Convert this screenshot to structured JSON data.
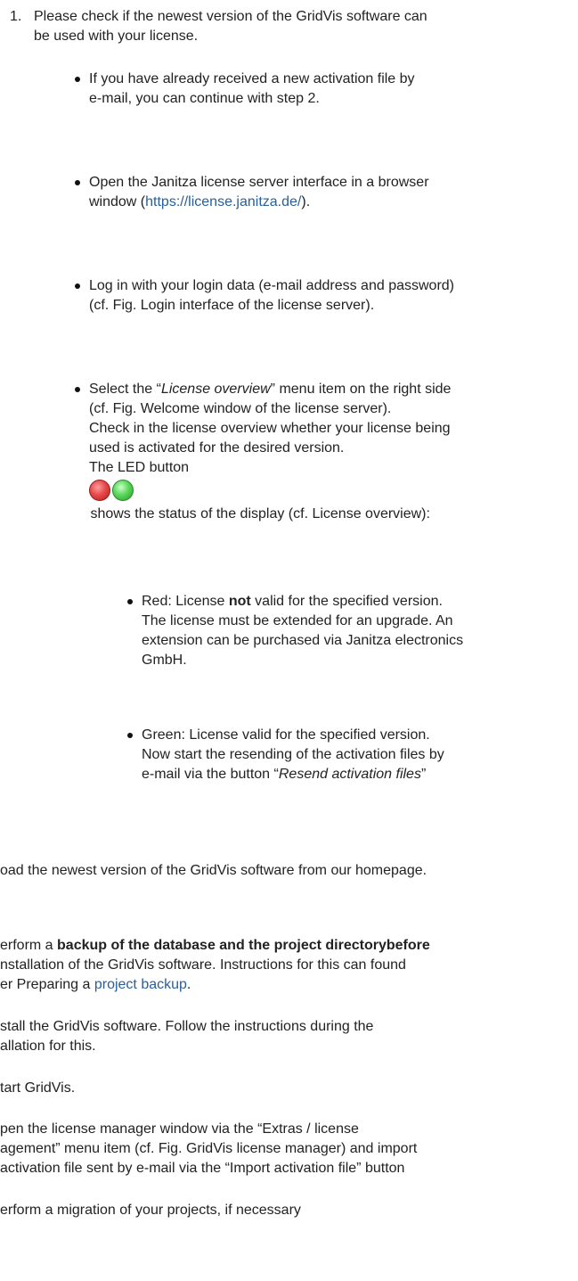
{
  "step1": {
    "number": "1.",
    "text_line1": "Please check if the newest version of the GridVis software can",
    "text_line2": "be used with your license."
  },
  "bullets": {
    "b1": {
      "line1": "If you have already received a new activation file by",
      "line2": "e-mail, you can continue with step 2."
    },
    "b2": {
      "line1": "Open the Janitza license server interface in a browser",
      "line2_prefix": "window (",
      "link": "https://license.janitza.de/",
      "line2_suffix": ")."
    },
    "b3": {
      "line1": "Log in with your login data (e-mail address and password)",
      "line2": "(cf. Fig. Login interface of the license server)."
    },
    "b4": {
      "line1_prefix": "Select the “",
      "line1_em": "License overview",
      "line1_suffix": "” menu item on the right side",
      "line2": "(cf. Fig. Welcome window of the license server).",
      "line3": "Check in the license overview whether your license being",
      "line4": "used is activated for the desired version.",
      "line5": "The LED button",
      "line6": " shows the status of the display (cf. License overview):"
    }
  },
  "sub_bullets": {
    "red": {
      "line1_prefix": "Red: License ",
      "line1_bold": "not",
      "line1_suffix": " valid for the specified version.",
      "line2": "The license must be extended for an upgrade. An",
      "line3": "extension can be purchased via Janitza electronics",
      "line4": "GmbH."
    },
    "green": {
      "line1": "Green: License valid for the specified version.",
      "line2": "Now start the resending of the activation files by",
      "line3_prefix": "e-mail via the button “",
      "line3_em": "Resend activation files",
      "line3_suffix": "”"
    }
  },
  "steps_cut": {
    "download": "oad the newest version of the GridVis software from our homepage.",
    "backup": {
      "line1_prefix": "erform a ",
      "line1_bold": "backup of the database and the project directorybefore",
      "line2": "nstallation of the GridVis software. Instructions for this can found",
      "line3_prefix": "er Preparing a ",
      "line3_link": "project backup",
      "line3_suffix": "."
    },
    "install": {
      "line1": "stall the GridVis software. Follow the instructions during the",
      "line2": "allation for this."
    },
    "start": "tart GridVis.",
    "license_manager": {
      "line1": "pen the license manager window via the “Extras / license",
      "line2": "agement” menu item (cf. Fig. GridVis license manager) and import",
      "line3": "activation file sent by e-mail via the “Import activation file” button"
    },
    "migration": "erform a migration of your projects, if necessary"
  },
  "colors": {
    "text": "#222222",
    "link": "#2a5f97",
    "led_red": "#e64a4a",
    "led_green": "#5bd65b"
  }
}
